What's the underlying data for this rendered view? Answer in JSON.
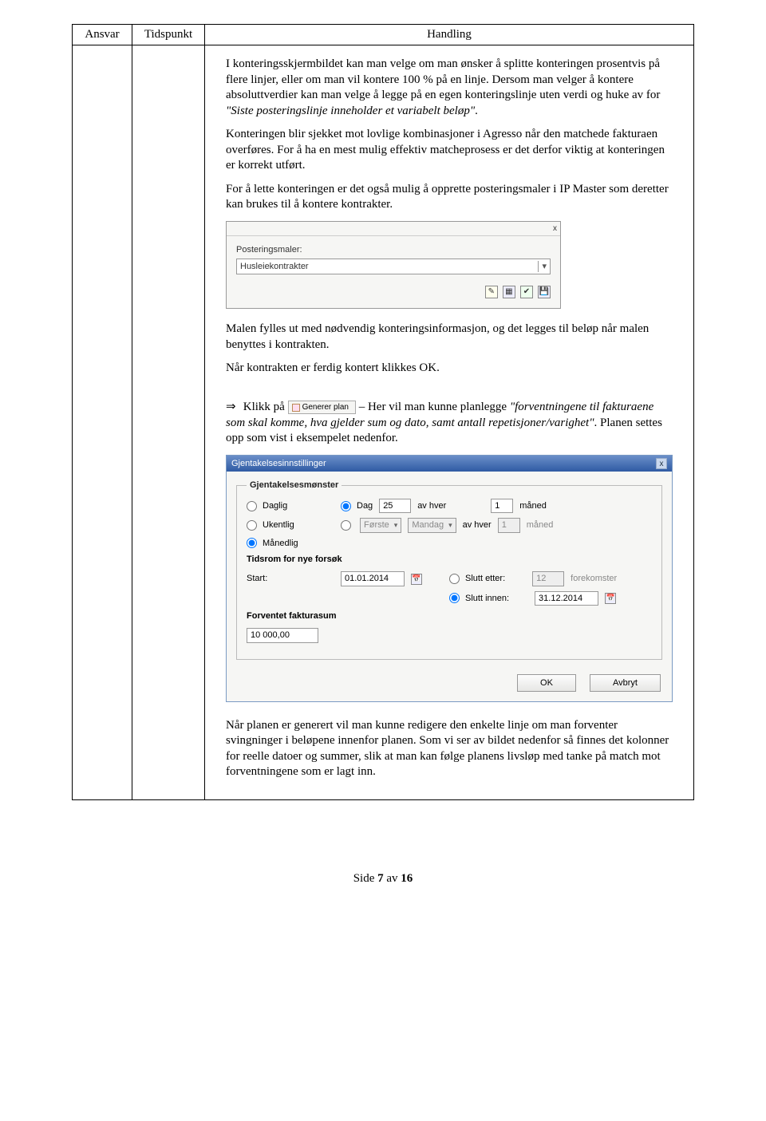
{
  "table": {
    "headers": {
      "ansvar": "Ansvar",
      "tidspunkt": "Tidspunkt",
      "handling": "Handling"
    }
  },
  "paragraphs": {
    "p1": "I konteringsskjermbildet kan man velge om man ønsker å splitte konteringen prosentvis på flere linjer, eller om man vil kontere 100 % på en linje. Dersom man velger å kontere absoluttverdier kan man velge å legge på en egen konteringslinje uten verdi og huke av for ",
    "p1_italic": "\"Siste posteringslinje inneholder et variabelt beløp\"",
    "p1_end": ".",
    "p2": "Konteringen blir sjekket mot lovlige kombinasjoner i Agresso når den matchede fakturaen overføres. For å ha en mest mulig effektiv matcheprosess er det derfor viktig at konteringen er korrekt utført.",
    "p3": "For å lette konteringen er det også mulig å opprette posteringsmaler i IP Master som deretter kan brukes til å kontere kontrakter.",
    "p4": "Malen fylles ut med nødvendig konteringsinformasjon, og det legges til beløp når malen benyttes i kontrakten.",
    "p5": "Når kontrakten er ferdig kontert klikkes OK.",
    "p6_pre": "Klikk på ",
    "p6_mid": " – Her vil man kunne planlegge ",
    "p6_italic": "\"forventningene til fakturaene som skal komme, hva gjelder sum og dato, samt antall repetisjoner/varighet\"",
    "p6_end": ". Planen settes opp som vist i eksempelet nedenfor.",
    "p7": "Når planen er generert vil man kunne redigere den enkelte linje om man forventer svingninger i beløpene innenfor planen. Som vi ser av bildet nedenfor så finnes det kolonner for reelle datoer og summer, slik at man kan følge planens livsløp med tanke på match mot forventningene som er lagt inn."
  },
  "posteringPanel": {
    "closeX": "x",
    "label": "Posteringsmaler:",
    "value": "Husleiekontrakter"
  },
  "genererPlanButton": "Generer plan",
  "dialog": {
    "title": "Gjentakelsesinnstillinger",
    "closeX": "x",
    "legend": "Gjentakelsesmønster",
    "radios": {
      "daglig": "Daglig",
      "ukentlig": "Ukentlig",
      "manedlig": "Månedlig",
      "dag": "Dag"
    },
    "fields": {
      "dagValue": "25",
      "avHver": "av hver",
      "avHverValue": "1",
      "maned": "måned",
      "forste": "Første",
      "mandag": "Mandag",
      "avHver2": "av hver",
      "avHver2Value": "1",
      "maned2": "måned"
    },
    "tidsrom": {
      "heading": "Tidsrom for nye forsøk",
      "startLabel": "Start:",
      "startValue": "01.01.2014",
      "sluttEtter": "Slutt etter:",
      "sluttEtterValue": "12",
      "forekomster": "forekomster",
      "sluttInnen": "Slutt innen:",
      "sluttInnenValue": "31.12.2014"
    },
    "forventet": {
      "heading": "Forventet fakturasum",
      "value": "10 000,00"
    },
    "buttons": {
      "ok": "OK",
      "avbryt": "Avbryt"
    }
  },
  "footer": {
    "prefix": "Side ",
    "page": "7",
    "mid": " av ",
    "total": "16"
  }
}
